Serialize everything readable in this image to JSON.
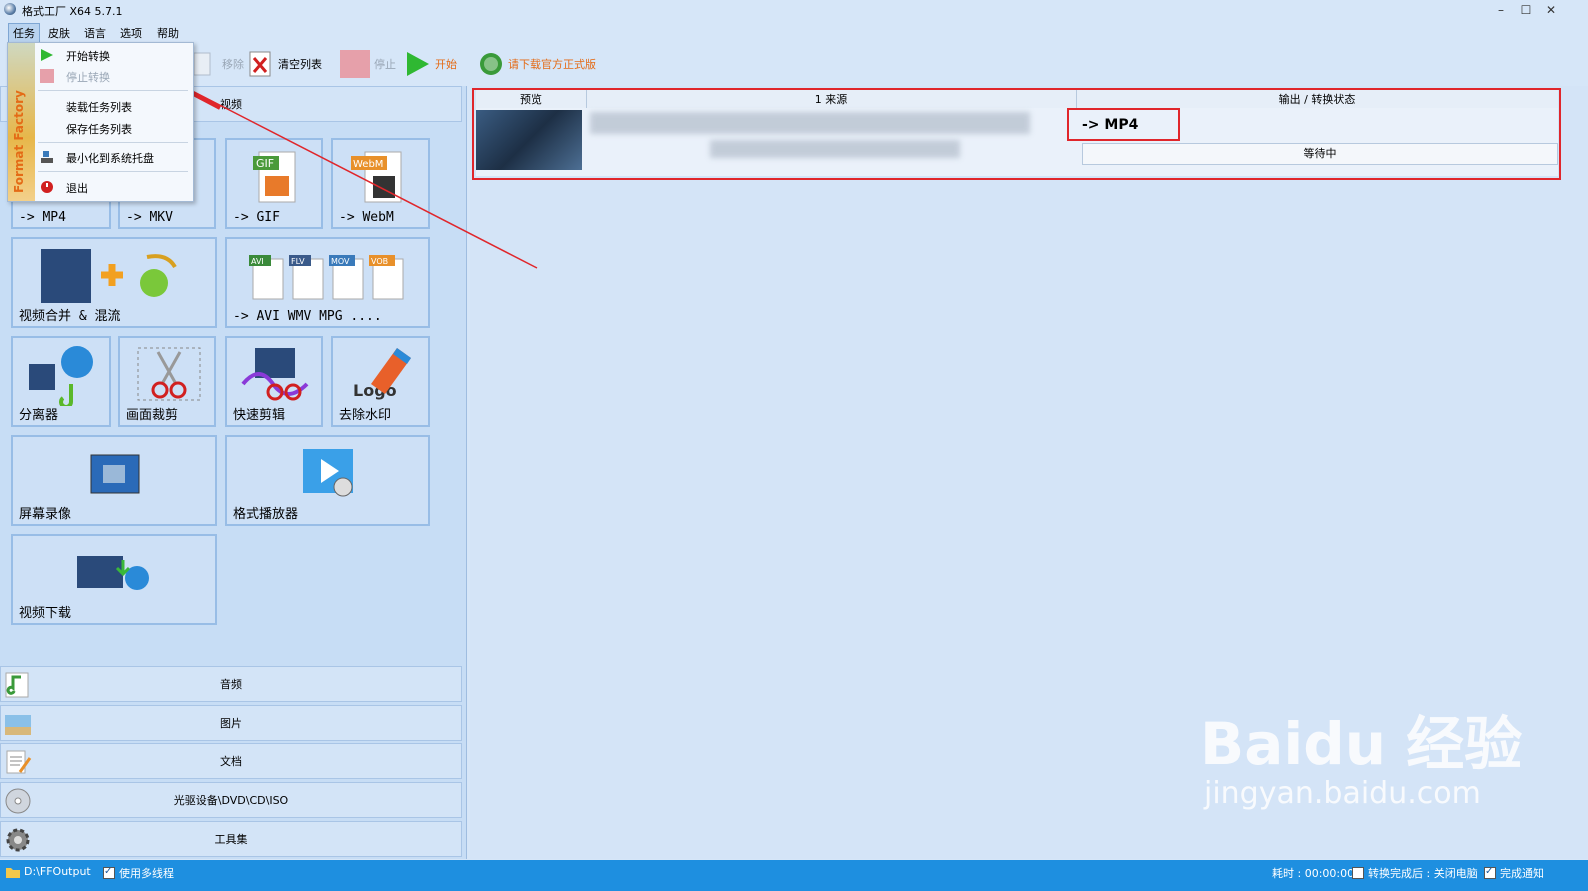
{
  "window": {
    "title": "格式工厂 X64 5.7.1",
    "minimize_icon": "minimize-icon",
    "maximize_icon": "maximize-icon",
    "close_icon": "close-icon"
  },
  "menubar": {
    "items": [
      "任务",
      "皮肤",
      "语言",
      "选项",
      "帮助"
    ]
  },
  "toolbar": {
    "remove": "移除",
    "clear_list": "清空列表",
    "stop": "停止",
    "start": "开始",
    "download_official": "请下载官方正式版"
  },
  "dropdown": {
    "brand": "Format Factory",
    "items": {
      "start_convert": "开始转换",
      "stop_convert": "停止转换",
      "load_tasks": "装载任务列表",
      "save_tasks": "保存任务列表",
      "minimize_tray": "最小化到系统托盘",
      "exit": "退出"
    }
  },
  "left": {
    "video_header": "视频",
    "tiles": {
      "mp4": "-> MP4",
      "mkv": "-> MKV",
      "gif": "-> GIF",
      "webm": "-> WebM",
      "merge": "视频合并 & 混流",
      "other": "-> AVI WMV MPG ....",
      "splitter": "分离器",
      "crop": "画面裁剪",
      "quick_cut": "快速剪辑",
      "watermark": "去除水印",
      "record": "屏幕录像",
      "player": "格式播放器",
      "download": "视频下载"
    },
    "tile_badges": {
      "gif": "GIF",
      "webm": "WebM",
      "avi": "AVI",
      "flv": "FLV",
      "mov": "MOV",
      "vob": "VOB",
      "logo": "Logo"
    },
    "categories": {
      "audio": "音频",
      "image": "图片",
      "document": "文档",
      "disc": "光驱设备\\DVD\\CD\\ISO",
      "tools": "工具集"
    }
  },
  "grid": {
    "headers": {
      "preview": "预览",
      "source": "1 来源",
      "output": "输出 / 转换状态"
    },
    "row": {
      "output_format": "-> MP4",
      "status": "等待中"
    }
  },
  "footer": {
    "output_path": "D:\\FFOutput",
    "multithread": "使用多线程",
    "elapsed": "耗时 : 00:00:00",
    "after_convert": "转换完成后 : 关闭电脑",
    "notify": "完成通知"
  },
  "watermark": {
    "brand": "Baidu 经验",
    "url": "jingyan.baidu.com"
  },
  "colors": {
    "accent_red": "#e0262b",
    "footer_blue": "#1e8fe0",
    "panel": "#c7ddf5"
  }
}
